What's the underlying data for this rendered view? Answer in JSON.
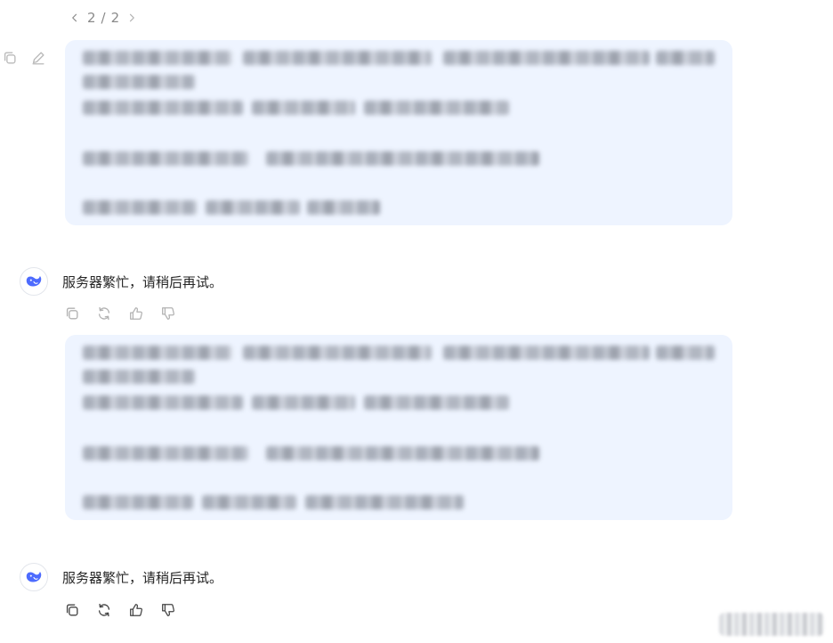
{
  "pager": {
    "current": "2",
    "separator": "/",
    "total": "2"
  },
  "replies": [
    {
      "text": "服务器繁忙，请稍后再试。"
    },
    {
      "text": "服务器繁忙，请稍后再试。"
    }
  ],
  "icons": {
    "copy": "copy-icon",
    "edit": "edit-icon",
    "regenerate": "regenerate-icon",
    "like": "thumbs-up-icon",
    "dislike": "thumbs-down-icon",
    "assistant": "whale-logo-icon"
  },
  "colors": {
    "bubble_bg": "#eef4ff",
    "brand": "#4d6bfe",
    "muted": "#8a8a8a"
  }
}
